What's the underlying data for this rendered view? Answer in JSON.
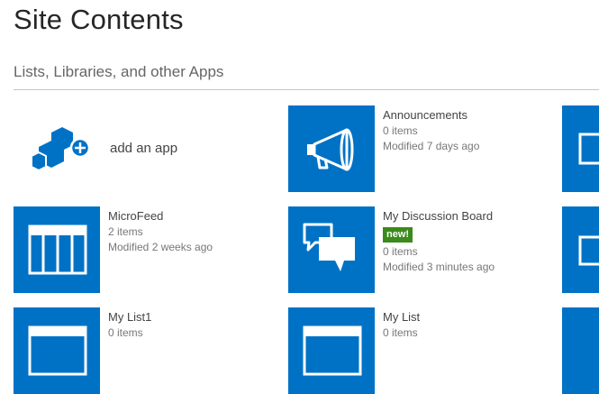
{
  "page": {
    "title": "Site Contents",
    "section_title": "Lists, Libraries, and other Apps"
  },
  "add_app": {
    "label": "add an app",
    "icon": "add-app-icon"
  },
  "apps": {
    "announcements": {
      "name": "Announcements",
      "items": "0 items",
      "modified": "Modified 7 days ago",
      "icon": "megaphone-icon"
    },
    "microfeed": {
      "name": "MicroFeed",
      "items": "2 items",
      "modified": "Modified 2 weeks ago",
      "icon": "list-icon"
    },
    "discussion": {
      "name": "My Discussion Board",
      "badge": "new!",
      "items": "0 items",
      "modified": "Modified 3 minutes ago",
      "icon": "discussion-icon"
    },
    "mylist1": {
      "name": "My List1",
      "items": "0 items",
      "icon": "list-icon"
    },
    "mylist": {
      "name": "My List",
      "items": "0 items",
      "icon": "list-icon"
    }
  },
  "colors": {
    "tile": "#0072c6",
    "badge": "#3b8a1c"
  }
}
